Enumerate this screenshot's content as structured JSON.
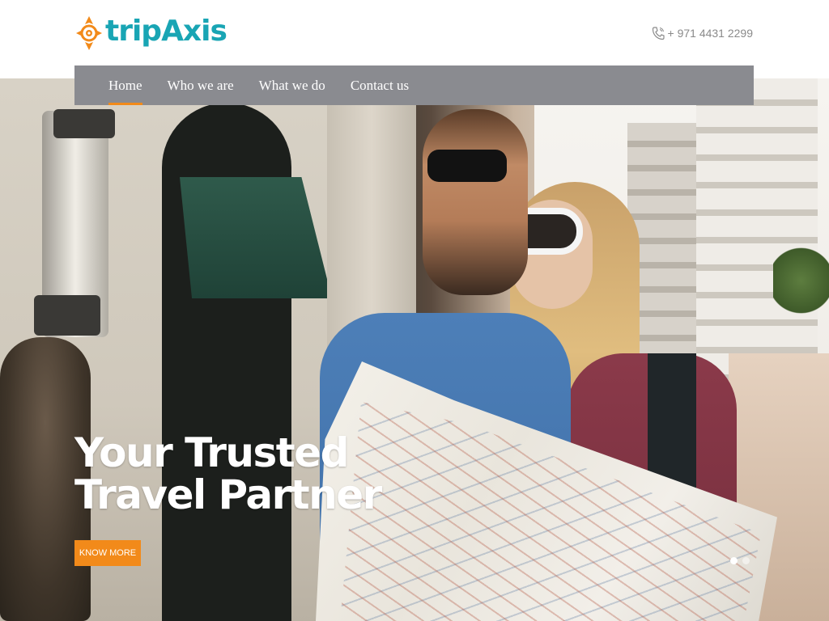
{
  "header": {
    "brand": "tripAxis",
    "phone": "+ 971 4431 2299",
    "brand_color": "#19a5b4",
    "accent_color": "#f28a1a"
  },
  "nav": {
    "items": [
      {
        "label": "Home",
        "active": true
      },
      {
        "label": "Who we are",
        "active": false
      },
      {
        "label": "What we do",
        "active": false
      },
      {
        "label": "Contact us",
        "active": false
      }
    ],
    "bar_color": "#8a8b90"
  },
  "hero": {
    "title_line1": "Your Trusted",
    "title_line2": "Travel Partner",
    "cta_label": "KNOW MORE",
    "slide_count": 2,
    "active_slide": 1
  },
  "icons": {
    "logo": "compass-logo-icon",
    "phone": "phone-icon"
  }
}
